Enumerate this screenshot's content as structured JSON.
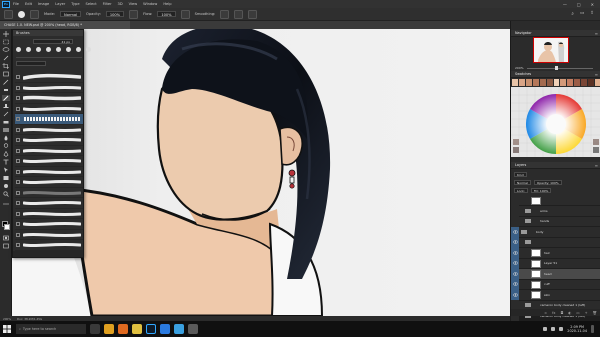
{
  "menubar": {
    "logo": "Ps",
    "items": [
      "File",
      "Edit",
      "Image",
      "Layer",
      "Type",
      "Select",
      "Filter",
      "3D",
      "View",
      "Window",
      "Help"
    ],
    "win_controls": [
      "—",
      "□",
      "✕"
    ]
  },
  "options": {
    "mode_label": "Mode:",
    "mode_value": "Normal",
    "opacity_label": "Opacity:",
    "opacity_value": "100%",
    "flow_label": "Flow:",
    "flow_value": "100%",
    "smoothing_label": "Smoothing:",
    "icons": [
      "brush-tool-icon",
      "brush-preset-icon",
      "brush-settings-icon",
      "pressure-opacity-icon",
      "airbrush-icon",
      "smoothing-gear-icon",
      "pressure-size-icon",
      "symmetry-icon"
    ]
  },
  "document": {
    "tab_title": "CHASE 1.0. NEW.psd @ 200% (head, RGB/8) *"
  },
  "brushes_panel": {
    "title": "Brushes",
    "size_value": "41 px"
  },
  "navigator": {
    "tab": "Navigator",
    "zoom": "200%"
  },
  "swatches": {
    "tab": "Swatches",
    "colors": [
      "#e8c4a8",
      "#d9a587",
      "#c8906f",
      "#b5785a",
      "#a36a4f",
      "#8c5a44",
      "#f1d1b8",
      "#d49a7a",
      "#c47e62",
      "#9b5c46",
      "#7a4636",
      "#5a3124",
      "#e0b090"
    ]
  },
  "layers": {
    "tab": "Layers",
    "kind_label": "Kind",
    "blend": "Normal",
    "opacity": "Opacity: 100%",
    "lock_label": "Lock:",
    "fill": "Fill: 100%",
    "rows": [
      {
        "name": "",
        "type": "layer",
        "indent": 2,
        "visible": false,
        "selected": false
      },
      {
        "name": "arms",
        "type": "folder",
        "indent": 1,
        "visible": false,
        "selected": false
      },
      {
        "name": "hands",
        "type": "folder",
        "indent": 1,
        "visible": false,
        "selected": false
      },
      {
        "name": "body",
        "type": "folder",
        "indent": 0,
        "visible": true,
        "selected": false
      },
      {
        "name": "",
        "type": "folder",
        "indent": 1,
        "visible": true,
        "selected": false
      },
      {
        "name": "hair",
        "type": "layer",
        "indent": 2,
        "visible": true,
        "selected": false
      },
      {
        "name": "Layer 51",
        "type": "layer",
        "indent": 2,
        "visible": true,
        "selected": false
      },
      {
        "name": "head",
        "type": "layer",
        "indent": 2,
        "visible": true,
        "selected": true
      },
      {
        "name": "cuff",
        "type": "layer",
        "indent": 2,
        "visible": true,
        "selected": false
      },
      {
        "name": "skin",
        "type": "layer",
        "indent": 2,
        "visible": true,
        "selected": false
      },
      {
        "name": "cameron body cleaned 1 (left)",
        "type": "folder",
        "indent": 1,
        "visible": false,
        "selected": false
      },
      {
        "name": "cameron body cleaned 1 (left)",
        "type": "folder",
        "indent": 1,
        "visible": false,
        "selected": false
      },
      {
        "name": "cameron body cleaned 1 (left)",
        "type": "folder",
        "indent": 1,
        "visible": false,
        "selected": false
      }
    ]
  },
  "statusbar": {
    "zoom": "200%",
    "doc": "Doc: 38.2M/1.45G"
  },
  "taskbar": {
    "search_placeholder": "Type here to search",
    "time": "2:09 PM",
    "date": "2020-11-04",
    "apps": [
      {
        "name": "task-view-icon",
        "color": "#3a3a3a"
      },
      {
        "name": "chrome-icon",
        "color": "#e0a020"
      },
      {
        "name": "firefox-icon",
        "color": "#e06a20"
      },
      {
        "name": "explorer-icon",
        "color": "#e0c040"
      },
      {
        "name": "photoshop-icon",
        "color": "#31a8ff"
      },
      {
        "name": "mail-icon",
        "color": "#2a7adf"
      },
      {
        "name": "store-icon",
        "color": "#3aa0e0"
      },
      {
        "name": "obs-icon",
        "color": "#5a5a5a"
      }
    ]
  }
}
